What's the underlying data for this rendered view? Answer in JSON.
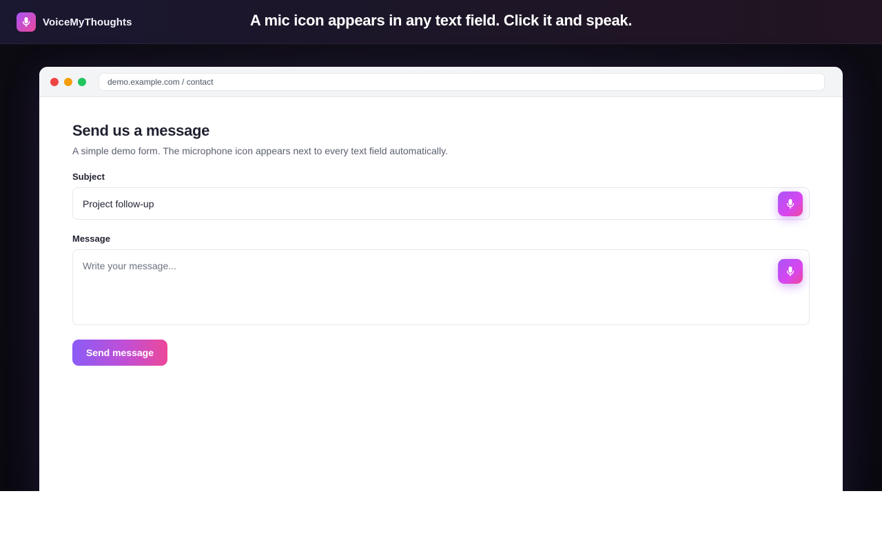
{
  "header": {
    "brand_name": "VoiceMyThoughts",
    "brand_icon": "microphone-icon",
    "tagline": "A mic icon appears in any text field. Click it and speak."
  },
  "browser": {
    "url": "demo.example.com / contact"
  },
  "form": {
    "title": "Send us a message",
    "subtitle": "A simple demo form. The microphone icon appears next to every text field automatically.",
    "subject_label": "Subject",
    "subject_value": "Project follow-up",
    "message_label": "Message",
    "message_placeholder": "Write your message...",
    "mic_icon": "microphone-icon",
    "send_label": "Send message"
  },
  "colors": {
    "accent_start": "#a855f7",
    "accent_end": "#ec4899"
  }
}
